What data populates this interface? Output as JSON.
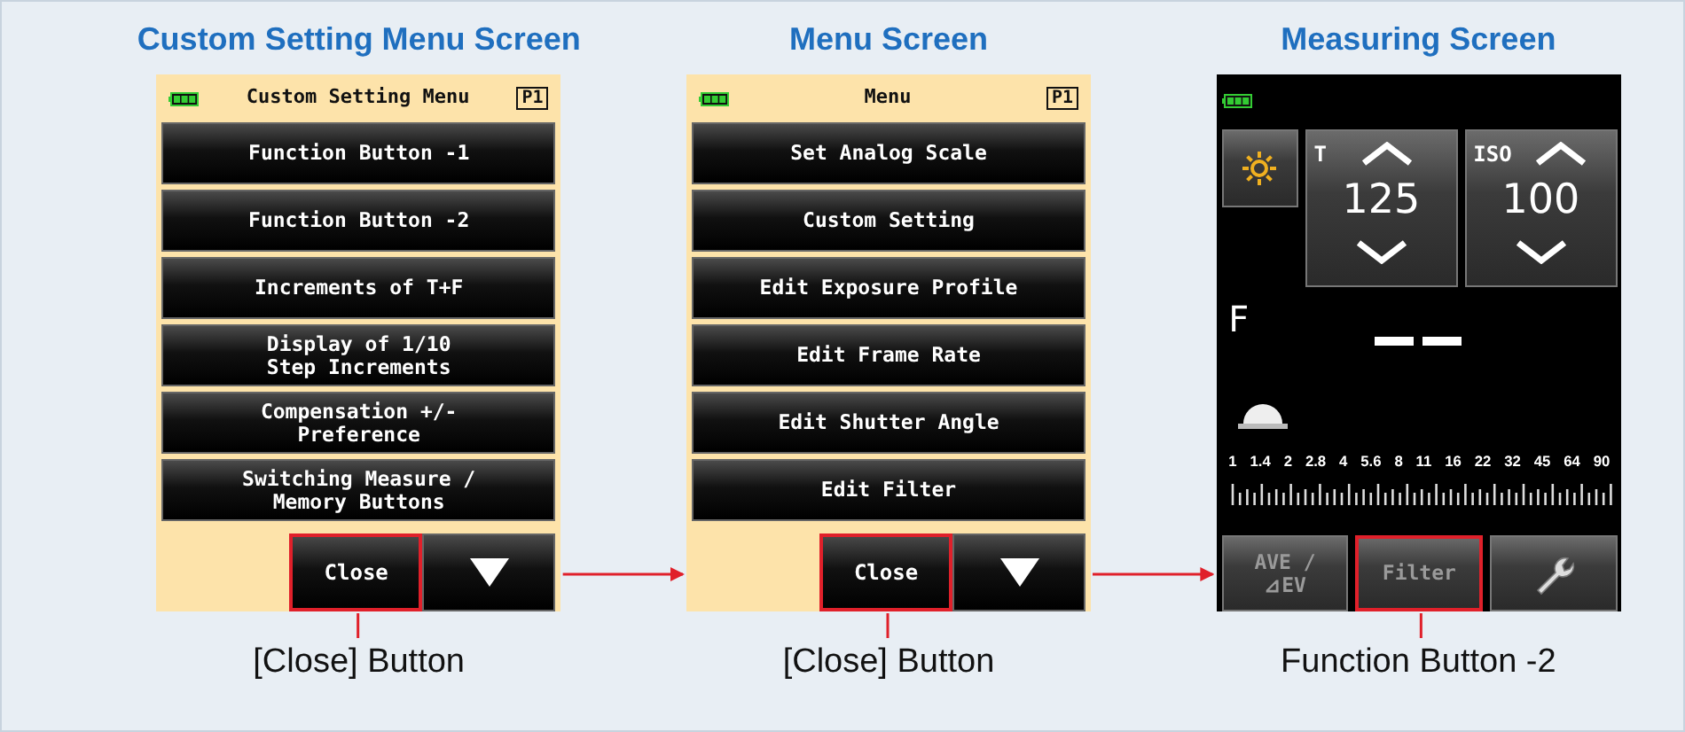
{
  "panels": [
    {
      "kind": "menu",
      "heading": "Custom Setting Menu Screen",
      "screen_title": "Custom Setting Menu",
      "page_badge": "P1",
      "items": [
        {
          "lines": [
            "Function Button -1"
          ]
        },
        {
          "lines": [
            "Function Button -2"
          ]
        },
        {
          "lines": [
            "Increments of T+F"
          ]
        },
        {
          "lines": [
            "Display of 1/10",
            "Step Increments"
          ]
        },
        {
          "lines": [
            "Compensation +/-",
            "Preference"
          ]
        },
        {
          "lines": [
            "Switching Measure /",
            "Memory Buttons"
          ]
        }
      ],
      "close_button": {
        "label": "Close",
        "highlighted": true
      },
      "caption": "[Close] Button"
    },
    {
      "kind": "menu",
      "heading": "Menu Screen",
      "screen_title": "Menu",
      "page_badge": "P1",
      "items": [
        {
          "lines": [
            "Set Analog Scale"
          ]
        },
        {
          "lines": [
            "Custom Setting"
          ]
        },
        {
          "lines": [
            "Edit Exposure Profile"
          ]
        },
        {
          "lines": [
            "Edit Frame Rate"
          ]
        },
        {
          "lines": [
            "Edit Shutter Angle"
          ]
        },
        {
          "lines": [
            "Edit Filter"
          ]
        }
      ],
      "close_button": {
        "label": "Close",
        "highlighted": true
      },
      "caption": "[Close] Button"
    },
    {
      "kind": "measuring",
      "heading": "Measuring Screen",
      "shutter": {
        "label": "T",
        "value": "125"
      },
      "iso": {
        "label": "ISO",
        "value": "100"
      },
      "aperture_label": "F",
      "scale_labels": [
        "1",
        "1.4",
        "2",
        "2.8",
        "4",
        "5.6",
        "8",
        "11",
        "16",
        "22",
        "32",
        "45",
        "64",
        "90"
      ],
      "buttons": [
        {
          "kind": "text",
          "lines": [
            "AVE /",
            "⊿EV"
          ],
          "dimmed": true,
          "highlighted": false
        },
        {
          "kind": "text",
          "lines": [
            "Filter"
          ],
          "dimmed": true,
          "highlighted": true
        },
        {
          "kind": "wrench",
          "dimmed": false,
          "highlighted": false
        }
      ],
      "caption": "Function Button -2"
    }
  ]
}
